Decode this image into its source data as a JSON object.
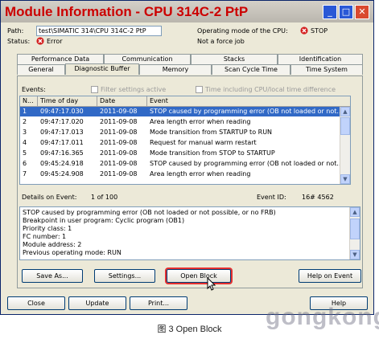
{
  "window": {
    "title": "Module Information - CPU 314C-2 PtP",
    "controls": {
      "minimize": "_",
      "maximize": "□",
      "close": "✕"
    }
  },
  "info": {
    "path_label": "Path:",
    "path_value": "test\\SIMATIC 314\\CPU 314C-2 PtP",
    "status_label": "Status:",
    "status_value": "Error",
    "opmode_label": "Operating mode of the  CPU:",
    "opmode_value": "STOP",
    "force_text": "Not a force job"
  },
  "tabs": {
    "row_back": [
      "Performance Data",
      "Communication",
      "Stacks",
      "Identification"
    ],
    "row_front": [
      "General",
      "Diagnostic Buffer",
      "Memory",
      "Scan Cycle Time",
      "Time System"
    ],
    "active": "Diagnostic Buffer"
  },
  "events": {
    "label": "Events:",
    "filter_label": "Filter settings active",
    "timezone_label": "Time including CPU/local time difference",
    "columns": [
      "N...",
      "Time of day",
      "Date",
      "Event"
    ],
    "rows": [
      {
        "n": "1",
        "time": "09:47:17.030",
        "date": "2011-09-08",
        "event": "STOP caused by programming error (OB not loaded or not..."
      },
      {
        "n": "2",
        "time": "09:47:17.020",
        "date": "2011-09-08",
        "event": "Area length error when reading"
      },
      {
        "n": "3",
        "time": "09:47:17.013",
        "date": "2011-09-08",
        "event": "Mode transition from STARTUP to RUN"
      },
      {
        "n": "4",
        "time": "09:47:17.011",
        "date": "2011-09-08",
        "event": "Request for manual warm restart"
      },
      {
        "n": "5",
        "time": "09:47:16.365",
        "date": "2011-09-08",
        "event": "Mode transition from STOP to STARTUP"
      },
      {
        "n": "6",
        "time": "09:45:24.918",
        "date": "2011-09-08",
        "event": "STOP caused by programming error (OB not loaded or not..."
      },
      {
        "n": "7",
        "time": "09:45:24.908",
        "date": "2011-09-08",
        "event": "Area length error when reading"
      }
    ],
    "selected_index": 0
  },
  "details": {
    "label": "Details on Event:",
    "count": "1 of 100",
    "event_id_label": "Event ID:",
    "event_id": "16# 4562",
    "lines": [
      "STOP caused by programming error (OB not loaded or not possible, or no FRB)",
      "Breakpoint in user program: Cyclic program (OB1)",
      "Priority class:   1",
      "FC number:     1",
      "Module address:     2",
      "Previous operating mode: RUN"
    ]
  },
  "buttons": {
    "save_as": "Save As...",
    "settings": "Settings...",
    "open_block": "Open Block",
    "help_on_event": "Help on Event",
    "close": "Close",
    "update": "Update",
    "print": "Print...",
    "help": "Help"
  },
  "caption": "图 3 Open Block",
  "watermark": "gongkong",
  "colors": {
    "title_text": "#cc0000",
    "selection": "#3169c6",
    "highlight_box": "#e53030"
  }
}
